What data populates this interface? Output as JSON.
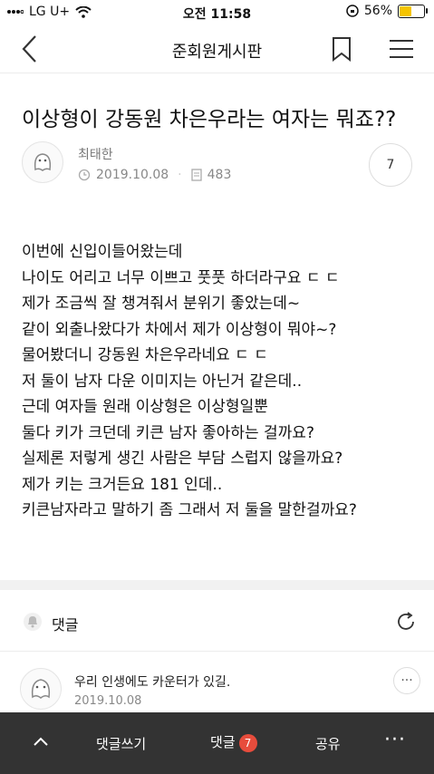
{
  "status_bar": {
    "carrier": "LG U+",
    "time": "오전 11:58",
    "battery_percent": "56%",
    "battery_level": 0.56
  },
  "nav": {
    "title": "준회원게시판",
    "back_icon": "chevron-left-icon",
    "bookmark_icon": "bookmark-icon",
    "menu_icon": "hamburger-menu-icon"
  },
  "post": {
    "title": "이상형이 강동원 차은우라는 여자는 뭐죠??",
    "author": "최태한",
    "date": "2019.10.08",
    "views": "483",
    "comment_count": "7",
    "body": [
      "이번에 신입이들어왔는데",
      "나이도 어리고 너무 이쁘고 풋풋 하더라구요 ㄷ ㄷ",
      "제가 조금씩 잘 챙겨줘서 분위기 좋았는데~",
      "같이 외출나왔다가 차에서 제가 이상형이 뭐야~?",
      "물어봤더니 강동원 차은우라네요 ㄷ ㄷ",
      "저 둘이 남자 다운 이미지는 아닌거 같은데..",
      "근데 여자들 원래 이상형은 이상형일뿐",
      "둘다 키가 크던데 키큰 남자 좋아하는 걸까요?",
      "실제론 저렇게 생긴 사람은 부담 스럽지 않을까요?",
      "제가 키는 크거든요 181 인데..",
      "키큰남자라고 말하기 좀 그래서 저 둘을 말한걸까요?"
    ]
  },
  "comments": {
    "header_label": "댓글",
    "items": [
      {
        "text": "우리 인생에도 카운터가 있길.",
        "date": "2019.10.08"
      }
    ]
  },
  "bottom_bar": {
    "write_comment": "댓글쓰기",
    "comments": "댓글",
    "comments_badge": "7",
    "share": "공유"
  },
  "colors": {
    "bottom_bar_bg": "#333333",
    "badge_red": "#e74c3c",
    "battery_yellow": "#f5c400"
  }
}
